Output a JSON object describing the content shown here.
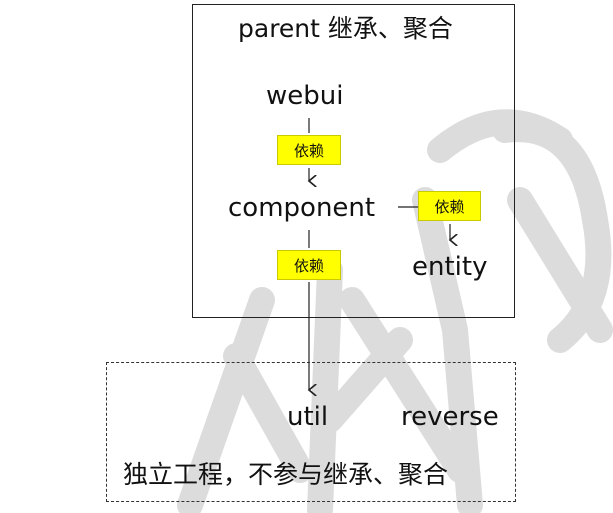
{
  "parent_group": {
    "title": "parent 继承、聚合"
  },
  "modules": {
    "webui": "webui",
    "component": "component",
    "entity": "entity",
    "util": "util",
    "reverse": "reverse"
  },
  "dependency_label": "依赖",
  "independent_group": {
    "caption": "独立工程，不参与继承、聚合"
  },
  "colors": {
    "dependency_highlight": "#ffff00",
    "border": "#222222",
    "watermark": "#d9d9d9"
  }
}
